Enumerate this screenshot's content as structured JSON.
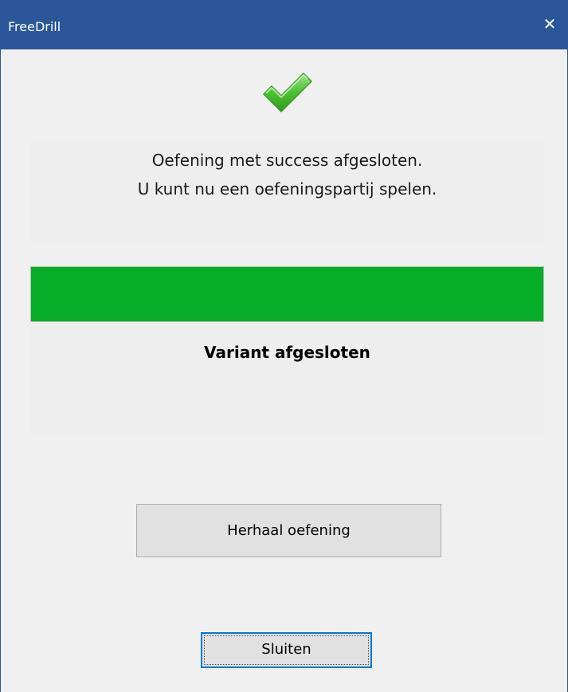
{
  "window": {
    "title": "FreeDrill",
    "close_label": "✕"
  },
  "status_icon": "check-icon",
  "message": {
    "line1": "Oefening met success afgesloten.",
    "line2": "U kunt nu een oefeningspartij spelen."
  },
  "progress": {
    "value_percent": 100,
    "color": "#06ad26"
  },
  "status_text": "Variant afgesloten",
  "buttons": {
    "repeat_label": "Herhaal oefening",
    "close_label": "Sluiten"
  },
  "colors": {
    "titlebar": "#2b579a",
    "focus_border": "#0078d7"
  }
}
